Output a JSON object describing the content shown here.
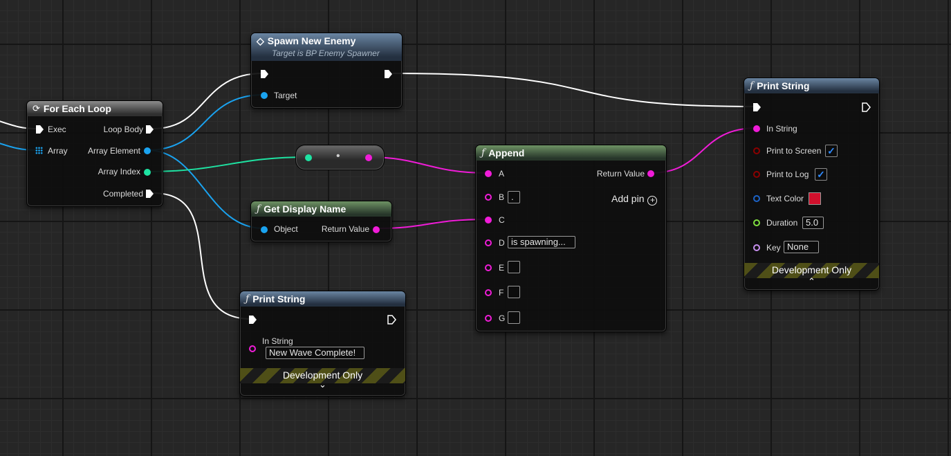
{
  "colors": {
    "exec": "#ffffff",
    "object": "#1aa3f0",
    "integer": "#1ee3a2",
    "string": "#f01cd8",
    "bool": "#8b0000",
    "struct": "#1c63c8",
    "float": "#80e040",
    "name": "#c890f0",
    "text_color_swatch": "#d0102c"
  },
  "for_each_loop": {
    "icon": "loop-icon",
    "title": "For Each Loop",
    "pins": {
      "exec": "Exec",
      "array": "Array",
      "loop_body": "Loop Body",
      "array_element": "Array Element",
      "array_index": "Array Index",
      "completed": "Completed"
    }
  },
  "spawn_new_enemy": {
    "icon": "event-diamond-icon",
    "title": "Spawn New Enemy",
    "subtitle": "Target is BP Enemy Spawner",
    "pins": {
      "target": "Target"
    }
  },
  "reroute": {
    "dot": "•"
  },
  "get_display_name": {
    "icon": "function-icon",
    "title": "Get Display Name",
    "pins": {
      "object": "Object",
      "return_value": "Return Value"
    }
  },
  "append": {
    "icon": "function-icon",
    "title": "Append",
    "pins": {
      "a": "A",
      "b": "B",
      "c": "C",
      "d": "D",
      "e": "E",
      "f": "F",
      "g": "G",
      "return_value": "Return Value"
    },
    "values": {
      "b": ".",
      "d": "is spawning...",
      "e": "",
      "f": "",
      "g": ""
    },
    "add_pin_label": "Add pin"
  },
  "print_string_bottom": {
    "icon": "function-icon",
    "title": "Print String",
    "pins": {
      "in_string": "In String"
    },
    "values": {
      "in_string": "New Wave Complete!"
    },
    "development_only": "Development Only",
    "chevron": "⌄"
  },
  "print_string_right": {
    "icon": "function-icon",
    "title": "Print String",
    "pins": {
      "in_string": "In String",
      "print_to_screen": "Print to Screen",
      "print_to_log": "Print to Log",
      "text_color": "Text Color",
      "duration": "Duration",
      "key": "Key"
    },
    "values": {
      "print_to_screen": true,
      "print_to_log": true,
      "duration": "5.0",
      "key": "None"
    },
    "development_only": "Development Only",
    "chevron": "⌃"
  }
}
